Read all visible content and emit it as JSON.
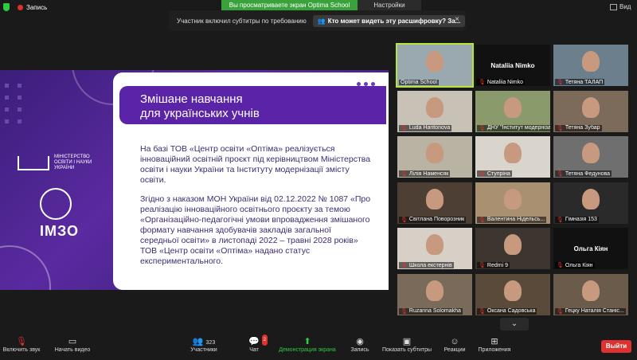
{
  "topbar": {
    "record_label": "Запись",
    "viewing_label": "Вы просматриваете экран Optima School",
    "view_options_label": "Настройки просмотра",
    "view_label": "Вид"
  },
  "caption": {
    "text": "Участник включил субтитры по требованию",
    "link": "Кто может видеть эту расшифровку? За...",
    "close": "×"
  },
  "slide": {
    "title_line1": "Змішане навчання",
    "title_line2": "для українських учнів",
    "para1": "На базі ТОВ «Центр освіти «Оптіма» реалізується інноваційний освітній проєкт під керівництвом Міністерства освіти і науки України та Інституту модернізації змісту освіти.",
    "para2": "Згідно з наказом МОН України від 02.12.2022 № 1087 «Про реалізацію інноваційного освітнього проєкту за темою «Організаційно-педагогічні умови впровадження змішаного формату навчання здобувачів закладів загальної середньої освіти» в листопаді 2022 – травні 2028 років» ТОВ «Центр освіти «Оптіма» надано статус експериментального.",
    "mon_text": "МІНІСТЕРСТВО ОСВІТИ І НАУКИ УКРАЇНИ",
    "imzo_text": "ІМЗО"
  },
  "gallery": {
    "tiles": [
      {
        "name": "Optima School",
        "muted": false,
        "big": ""
      },
      {
        "name": "Nataliia Nimko",
        "muted": true,
        "big": "Nataliia Nimko"
      },
      {
        "name": "Тетяна ТАЛАП",
        "muted": true,
        "big": ""
      },
      {
        "name": "Luda Haritonova",
        "muted": true,
        "big": ""
      },
      {
        "name": "ДНУ \"Інститут модерніза...",
        "muted": true,
        "big": ""
      },
      {
        "name": "Тетяна Зубар",
        "muted": true,
        "big": ""
      },
      {
        "name": "Лілія Наменсяк",
        "muted": true,
        "big": ""
      },
      {
        "name": "Ступріна",
        "muted": true,
        "big": ""
      },
      {
        "name": "Тетяна Федунова",
        "muted": true,
        "big": ""
      },
      {
        "name": "Світлана Поворозник",
        "muted": true,
        "big": ""
      },
      {
        "name": "Валентина Нідельсь...",
        "muted": true,
        "big": ""
      },
      {
        "name": "Гімназія 153",
        "muted": true,
        "big": ""
      },
      {
        "name": "Школа екстернів",
        "muted": true,
        "big": ""
      },
      {
        "name": "Redmi 9",
        "muted": true,
        "big": ""
      },
      {
        "name": "Ольга Кіян",
        "muted": true,
        "big": "Ольга Кіян"
      },
      {
        "name": "Ruzanna Solomakha",
        "muted": true,
        "big": ""
      },
      {
        "name": "Оксана Садовська",
        "muted": true,
        "big": ""
      },
      {
        "name": "Гецку Наталія Станіс...",
        "muted": true,
        "big": ""
      }
    ]
  },
  "toolbar": {
    "unmute": "Включить звук",
    "start_video": "Начать видео",
    "participants": "Участники",
    "participants_count": "323",
    "chat": "Чат",
    "chat_badge": "2",
    "share_screen": "Демонстрация экрана",
    "record": "Запись",
    "captions": "Показать субтитры",
    "reactions": "Реакции",
    "apps": "Приложения",
    "leave": "Выйти"
  },
  "colors": {
    "accent_green": "#2ecc40",
    "leave_red": "#e03131",
    "slide_purple": "#5b23a8"
  }
}
